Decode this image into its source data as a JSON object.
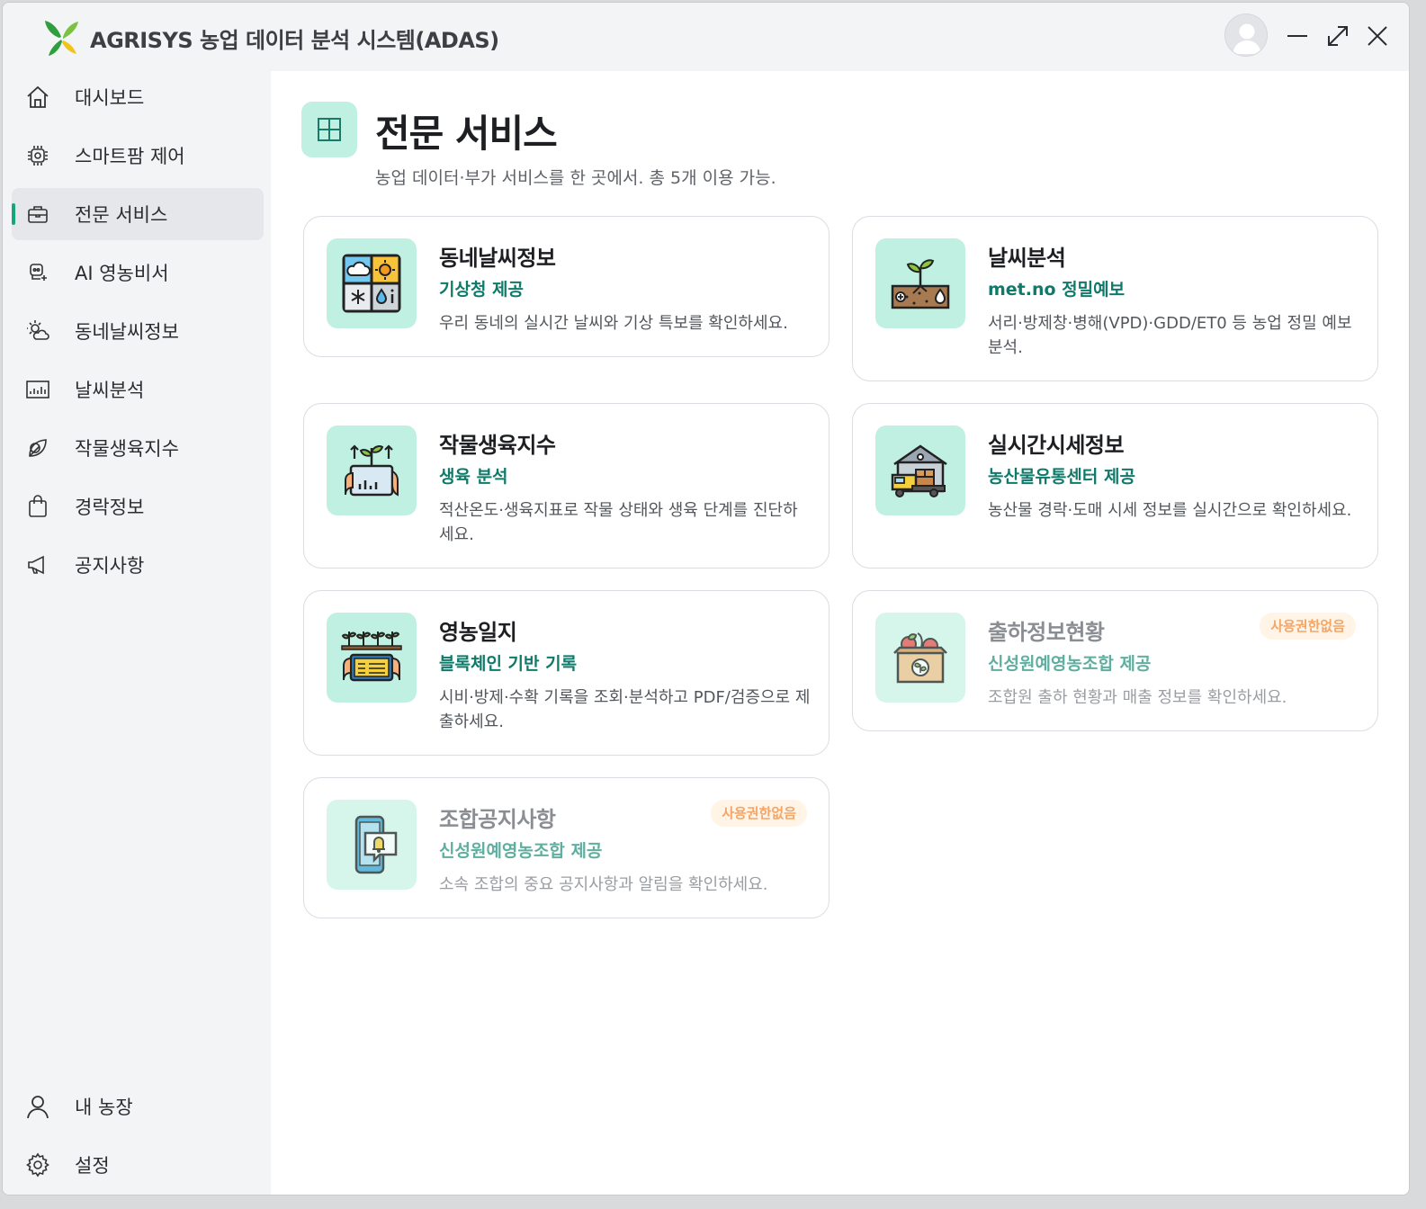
{
  "app": {
    "title": "AGRISYS 농업 데이터 분석 시스템(ADAS)"
  },
  "window_controls": {
    "minimize_icon": "minimize-icon",
    "maximize_icon": "maximize-icon",
    "close_icon": "close-icon"
  },
  "sidebar": {
    "items": [
      {
        "label": "대시보드",
        "icon": "home-icon"
      },
      {
        "label": "스마트팜 제어",
        "icon": "chip-icon"
      },
      {
        "label": "전문 서비스",
        "icon": "briefcase-icon",
        "active": true
      },
      {
        "label": "AI 영농비서",
        "icon": "robot-icon"
      },
      {
        "label": "동네날씨정보",
        "icon": "sun-cloud-icon"
      },
      {
        "label": "날씨분석",
        "icon": "chart-icon"
      },
      {
        "label": "작물생육지수",
        "icon": "leaf-icon"
      },
      {
        "label": "경락정보",
        "icon": "shopping-bag-icon"
      },
      {
        "label": "공지사항",
        "icon": "megaphone-icon"
      }
    ],
    "bottom": [
      {
        "label": "내 농장",
        "icon": "user-icon"
      },
      {
        "label": "설정",
        "icon": "gear-icon"
      }
    ],
    "accent_color": "#17a67b"
  },
  "page": {
    "title": "전문 서비스",
    "subtitle": "농업 데이터·부가 서비스를 한 곳에서. 총 5개 이용 가능.",
    "icon": "grid-icon"
  },
  "cards": [
    {
      "title": "동네날씨정보",
      "provider": "기상청 제공",
      "desc": "우리 동네의 실시간 날씨와 기상 특보를 확인하세요.",
      "icon": "weather-grid-icon",
      "enabled": true
    },
    {
      "title": "날씨분석",
      "provider": "met.no 정밀예보",
      "desc": "서리·방제창·병해(VPD)·GDD/ET0 등 농업 정밀 예보 분석.",
      "icon": "sprout-soil-icon",
      "enabled": true
    },
    {
      "title": "작물생육지수",
      "provider": "생육 분석",
      "desc": "적산온도·생육지표로 작물 상태와 생육 단계를 진단하세요.",
      "icon": "growth-tablet-icon",
      "enabled": true
    },
    {
      "title": "실시간시세정보",
      "provider": "농산물유통센터 제공",
      "desc": "농산물 경락·도매 시세 정보를 실시간으로 확인하세요.",
      "icon": "warehouse-truck-icon",
      "enabled": true
    },
    {
      "title": "영농일지",
      "provider": "블록체인 기반 기록",
      "desc": "시비·방제·수확 기록을 조회·분석하고 PDF/검증으로 제출하세요.",
      "icon": "farm-tablet-icon",
      "enabled": true
    },
    {
      "title": "출하정보현황",
      "provider": "신성원예영농조합 제공",
      "desc": "조합원 출하 현황과 매출 정보를 확인하세요.",
      "icon": "produce-box-icon",
      "enabled": false,
      "badge": "사용권한없음"
    },
    {
      "title": "조합공지사항",
      "provider": "신성원예영농조합 제공",
      "desc": "소속 조합의 중요 공지사항과 알림을 확인하세요.",
      "icon": "phone-bell-icon",
      "enabled": false,
      "badge": "사용권한없음"
    }
  ]
}
